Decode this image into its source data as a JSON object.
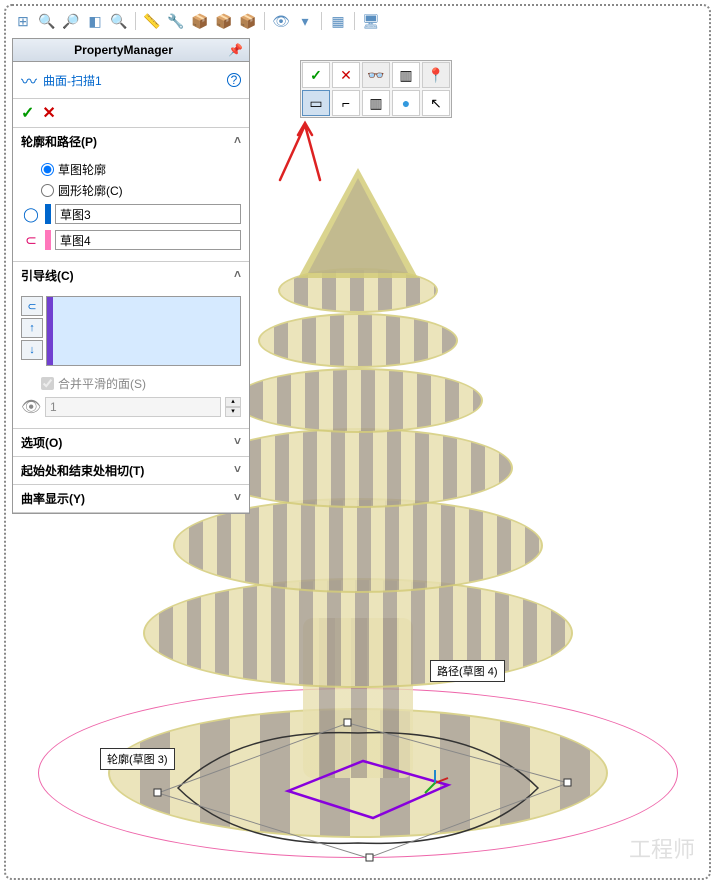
{
  "pm": {
    "header": "PropertyManager",
    "feature_name": "曲面-扫描1",
    "sections": {
      "profile_path": {
        "title": "轮廓和路径(P)",
        "radio_sketch": "草图轮廓",
        "radio_circle": "圆形轮廓(C)",
        "profile_value": "草图3",
        "path_value": "草图4"
      },
      "guide": {
        "title": "引导线(C)",
        "merge_check": "合并平滑的面(S)",
        "spinner_value": "1"
      },
      "options": {
        "title": "选项(O)"
      },
      "tangent": {
        "title": "起始处和结束处相切(T)"
      },
      "curvature": {
        "title": "曲率显示(Y)"
      }
    }
  },
  "callouts": {
    "profile": "轮廓(草图 3)",
    "path": "路径(草图 4)"
  },
  "watermark": "工程师"
}
